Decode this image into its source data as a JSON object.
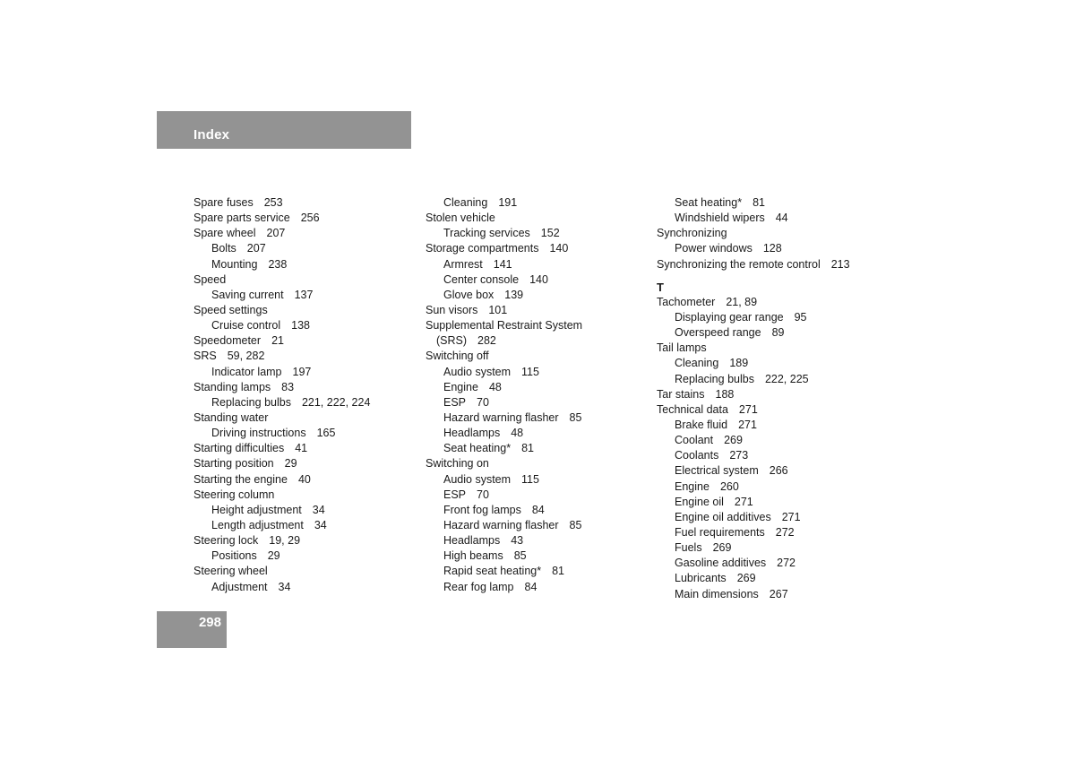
{
  "header": {
    "title": "Index"
  },
  "page_number": "298",
  "columns": [
    {
      "entries": [
        {
          "type": "main",
          "term": "Spare fuses",
          "pages": "253"
        },
        {
          "type": "main",
          "term": "Spare parts service",
          "pages": "256"
        },
        {
          "type": "main",
          "term": "Spare wheel",
          "pages": "207"
        },
        {
          "type": "sub",
          "term": "Bolts",
          "pages": "207"
        },
        {
          "type": "sub",
          "term": "Mounting",
          "pages": "238"
        },
        {
          "type": "main",
          "term": "Speed",
          "pages": ""
        },
        {
          "type": "sub",
          "term": "Saving current",
          "pages": "137"
        },
        {
          "type": "main",
          "term": "Speed settings",
          "pages": ""
        },
        {
          "type": "sub",
          "term": "Cruise control",
          "pages": "138"
        },
        {
          "type": "main",
          "term": "Speedometer",
          "pages": "21"
        },
        {
          "type": "main",
          "term": "SRS",
          "pages": "59, 282"
        },
        {
          "type": "sub",
          "term": "Indicator lamp",
          "pages": "197"
        },
        {
          "type": "main",
          "term": "Standing lamps",
          "pages": "83"
        },
        {
          "type": "sub",
          "term": "Replacing bulbs",
          "pages": "221, 222, 224"
        },
        {
          "type": "main",
          "term": "Standing water",
          "pages": ""
        },
        {
          "type": "sub",
          "term": "Driving instructions",
          "pages": "165"
        },
        {
          "type": "main",
          "term": "Starting difficulties",
          "pages": "41"
        },
        {
          "type": "main",
          "term": "Starting position",
          "pages": "29"
        },
        {
          "type": "main",
          "term": "Starting the engine",
          "pages": "40"
        },
        {
          "type": "main",
          "term": "Steering column",
          "pages": ""
        },
        {
          "type": "sub",
          "term": "Height adjustment",
          "pages": "34"
        },
        {
          "type": "sub",
          "term": "Length adjustment",
          "pages": "34"
        },
        {
          "type": "main",
          "term": "Steering lock",
          "pages": "19, 29"
        },
        {
          "type": "sub",
          "term": "Positions",
          "pages": "29"
        },
        {
          "type": "main",
          "term": "Steering wheel",
          "pages": ""
        },
        {
          "type": "sub",
          "term": "Adjustment",
          "pages": "34"
        }
      ]
    },
    {
      "entries": [
        {
          "type": "sub",
          "term": "Cleaning",
          "pages": "191"
        },
        {
          "type": "main",
          "term": "Stolen vehicle",
          "pages": ""
        },
        {
          "type": "sub",
          "term": "Tracking services",
          "pages": "152"
        },
        {
          "type": "main",
          "term": "Storage compartments",
          "pages": "140"
        },
        {
          "type": "sub",
          "term": "Armrest",
          "pages": "141"
        },
        {
          "type": "sub",
          "term": "Center console",
          "pages": "140"
        },
        {
          "type": "sub",
          "term": "Glove box",
          "pages": "139"
        },
        {
          "type": "main",
          "term": "Sun visors",
          "pages": "101"
        },
        {
          "type": "main",
          "term": "Supplemental Restraint System",
          "pages": ""
        },
        {
          "type": "cont",
          "term": "(SRS)",
          "pages": "282"
        },
        {
          "type": "main",
          "term": "Switching off",
          "pages": ""
        },
        {
          "type": "sub",
          "term": "Audio system",
          "pages": "115"
        },
        {
          "type": "sub",
          "term": "Engine",
          "pages": "48"
        },
        {
          "type": "sub",
          "term": "ESP",
          "pages": "70"
        },
        {
          "type": "sub",
          "term": "Hazard warning flasher",
          "pages": "85"
        },
        {
          "type": "sub",
          "term": "Headlamps",
          "pages": "48"
        },
        {
          "type": "sub",
          "term": "Seat heating*",
          "pages": "81"
        },
        {
          "type": "main",
          "term": "Switching on",
          "pages": ""
        },
        {
          "type": "sub",
          "term": "Audio system",
          "pages": "115"
        },
        {
          "type": "sub",
          "term": "ESP",
          "pages": "70"
        },
        {
          "type": "sub",
          "term": "Front fog lamps",
          "pages": "84"
        },
        {
          "type": "sub",
          "term": "Hazard warning flasher",
          "pages": "85"
        },
        {
          "type": "sub",
          "term": "Headlamps",
          "pages": "43"
        },
        {
          "type": "sub",
          "term": "High beams",
          "pages": "85"
        },
        {
          "type": "sub",
          "term": "Rapid seat heating*",
          "pages": "81"
        },
        {
          "type": "sub",
          "term": "Rear fog lamp",
          "pages": "84"
        }
      ]
    },
    {
      "entries": [
        {
          "type": "sub",
          "term": "Seat heating*",
          "pages": "81"
        },
        {
          "type": "sub",
          "term": "Windshield wipers",
          "pages": "44"
        },
        {
          "type": "main",
          "term": "Synchronizing",
          "pages": ""
        },
        {
          "type": "sub",
          "term": "Power windows",
          "pages": "128"
        },
        {
          "type": "main",
          "term": "Synchronizing the remote control",
          "pages": "213"
        },
        {
          "type": "letter",
          "term": "T",
          "pages": ""
        },
        {
          "type": "main",
          "term": "Tachometer",
          "pages": "21, 89"
        },
        {
          "type": "sub",
          "term": "Displaying gear range",
          "pages": "95"
        },
        {
          "type": "sub",
          "term": "Overspeed range",
          "pages": "89"
        },
        {
          "type": "main",
          "term": "Tail lamps",
          "pages": ""
        },
        {
          "type": "sub",
          "term": "Cleaning",
          "pages": "189"
        },
        {
          "type": "sub",
          "term": "Replacing bulbs",
          "pages": "222, 225"
        },
        {
          "type": "main",
          "term": "Tar stains",
          "pages": "188"
        },
        {
          "type": "main",
          "term": "Technical data",
          "pages": "271"
        },
        {
          "type": "sub",
          "term": "Brake fluid",
          "pages": "271"
        },
        {
          "type": "sub",
          "term": "Coolant",
          "pages": "269"
        },
        {
          "type": "sub",
          "term": "Coolants",
          "pages": "273"
        },
        {
          "type": "sub",
          "term": "Electrical system",
          "pages": "266"
        },
        {
          "type": "sub",
          "term": "Engine",
          "pages": "260"
        },
        {
          "type": "sub",
          "term": "Engine oil",
          "pages": "271"
        },
        {
          "type": "sub",
          "term": "Engine oil additives",
          "pages": "271"
        },
        {
          "type": "sub",
          "term": "Fuel requirements",
          "pages": "272"
        },
        {
          "type": "sub",
          "term": "Fuels",
          "pages": "269"
        },
        {
          "type": "sub",
          "term": "Gasoline additives",
          "pages": "272"
        },
        {
          "type": "sub",
          "term": "Lubricants",
          "pages": "269"
        },
        {
          "type": "sub",
          "term": "Main dimensions",
          "pages": "267"
        }
      ]
    }
  ]
}
